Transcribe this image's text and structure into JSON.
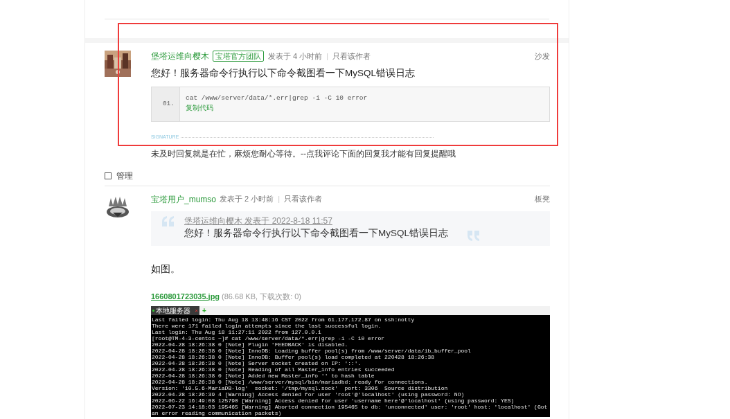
{
  "posts": [
    {
      "author": "堡塔运维向樱木",
      "badge": "宝塔官方团队",
      "posted": "发表于 4 小时前",
      "separator": "|",
      "only_author": "只看该作者",
      "floor": "沙发",
      "body": "您好！服务器命令行执行以下命令截图看一下MySQL错误日志",
      "code": {
        "line_number": "01.",
        "text": "cat /www/server/data/*.err|grep -i -C 10 error",
        "copy": "复制代码"
      },
      "signature_label": "SIGNATURE",
      "signature": "未及时回复就是在忙，麻烦您耐心等待。--点我评论下面的回复我才能有回复提醒哦"
    },
    {
      "author": "宝塔用户_mumso",
      "posted": "发表于 2 小时前",
      "separator": "|",
      "only_author": "只看该作者",
      "floor": "板凳",
      "quote": {
        "header": "堡塔运维向樱木 发表于 2022-8-18 11:57",
        "text": "您好！服务器命令行执行以下命令截图看一下MySQL错误日志"
      },
      "body": "如图。",
      "attachment": {
        "name": "1660801723035.jpg",
        "info": "(86.68 KB, 下载次数: 0)"
      },
      "screenshot": {
        "tab": "本地服务器",
        "tab_close": "×",
        "add": "+",
        "lines": [
          "Last failed login: Thu Aug 18 13:48:16 CST 2022 from 61.177.172.87 on ssh:notty",
          "There were 171 failed login attempts since the last successful login.",
          "Last login: Thu Aug 18 11:27:11 2022 from 127.0.0.1",
          "[root@TM-4-3-centos ~]# cat /www/server/data/*.err|grep -i -C 10 error",
          "2022-04-28 18:26:38 0 [Note] Plugin 'FEEDBACK' is disabled.",
          "2022-04-28 18:26:38 0 [Note] InnoDB: Loading buffer pool(s) from /www/server/data/ib_buffer_pool",
          "2022-04-28 18:26:38 0 [Note] InnoDB: Buffer pool(s) load completed at 220428 18:26:38",
          "2022-04-28 18:26:38 0 [Note] Server socket created on IP: '::'.",
          "2022-04-28 18:26:38 0 [Note] Reading of all Master_info entries succeeded",
          "2022-04-28 18:26:38 0 [Note] Added new Master_info '' to hash table",
          "2022-04-28 18:26:38 0 [Note] /www/server/mysql/bin/mariadbd: ready for connections.",
          "Version: '10.5.6-MariaDB-log'  socket: '/tmp/mysql.sock'  port: 3306  Source distribution",
          "2022-04-28 18:26:39 4 [Warning] Access denied for user 'root'@'localhost' (using password: NO)",
          "2022-06-22 16:49:08 125790 [Warning] Access denied for user 'username here'@'localhost' (using password: YES)",
          "2022-07-23 14:18:03 195465 [Warning] Aborted connection 195465 to db: 'unconnected' user: 'root' host: 'localhost' (Got an error reading communication packets)"
        ]
      }
    }
  ],
  "manage": {
    "label": "管理",
    "checked": false
  }
}
